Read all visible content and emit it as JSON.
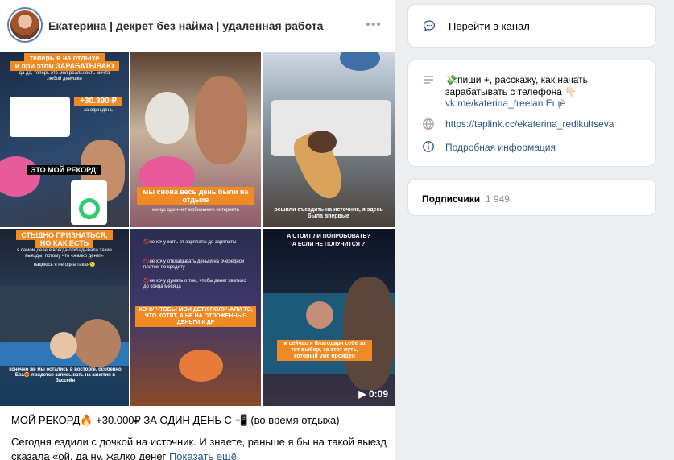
{
  "post": {
    "author": "Екатерина | декрет без найма | удаленная работа",
    "more_glyph": "•••",
    "title": "МОЙ РЕКОРД🔥 +30.000₽ ЗА ОДИН ДЕНЬ С 📲 (во время отдыха)",
    "text": "Сегодня ездили с дочкой на источник. И знаете, раньше я бы на такой выезд сказала «ой, да ну, жалко денег",
    "show_more": "Показать ещё",
    "tiles": {
      "t1": {
        "cap1": "теперь я на отдыхе",
        "cap2": "и при этом ЗАРАБАТЫВАЮ",
        "cap3": "да да, теперь это моя реальность-мечта любой девушки",
        "amount": "+30.390 ₽",
        "amount_sub": "за один день",
        "record": "ЭТО МОЙ РЕКОРД!"
      },
      "t2": {
        "cap1": "мы снова весь день были на отдыхе",
        "cap2": "минус один-нет мобильного интернета"
      },
      "t3": {
        "cap1": "решили съездить на источник, я здесь была впервые"
      },
      "t4": {
        "cap1": "СТЫДНО ПРИЗНАТЬСЯ,",
        "cap2": "НО КАК ЕСТЬ",
        "cap3": "я самом деле я всегда откладывала такие выезды, потому что «жалко денег»",
        "cap4": "надеюсь я не одна такая😕",
        "cap5": "конечно же мы  остались в восторге, особенно Ева😍 придется записывать на занятия в бассейн"
      },
      "t5": {
        "cap1": "🚫не хочу жить от зарплаты до зарплаты",
        "cap2": "🚫не хочу откладывать деньги на очередной платеж по кредиту",
        "cap3": "🚫не хочу думать о том, чтобы денег хватило до конца месяца",
        "cap4": "ХОЧУ ЧТОБЫ МОИ ДЕТИ ПОЛУЧАЛИ ТО, ЧТО ХОТЯТ, А НЕ НА ОТЛОЖЕННЫЕ ДЕНЬГИ К ДР"
      },
      "t6": {
        "cap1": "А СТОИТ ЛИ ПОПРОБОВАТЬ?",
        "cap2": "А ЕСЛИ НЕ ПОЛУЧИТСЯ ?",
        "cap3": "и сейчас я благодаря себе за тот выбор, за этот путь, который уже пройден",
        "duration": "0:09"
      }
    }
  },
  "sidebar": {
    "go_channel": "Перейти в канал",
    "desc_line1": "💸пиши +, расскажу, как начать",
    "desc_line2": "зарабатывать с телефона 👇🏻",
    "desc_link": "vk.me/katerina_freelan",
    "desc_more": "Ещё",
    "website": "https://taplink.cc/ekaterina_redikultseva",
    "details": "Подробная информация",
    "subscribers_label": "Подписчики",
    "subscribers_count": "1 949"
  },
  "colors": {
    "accent": "#2a5885",
    "orange_caption": "#f08a24",
    "icon_gray": "#99a2ad"
  }
}
